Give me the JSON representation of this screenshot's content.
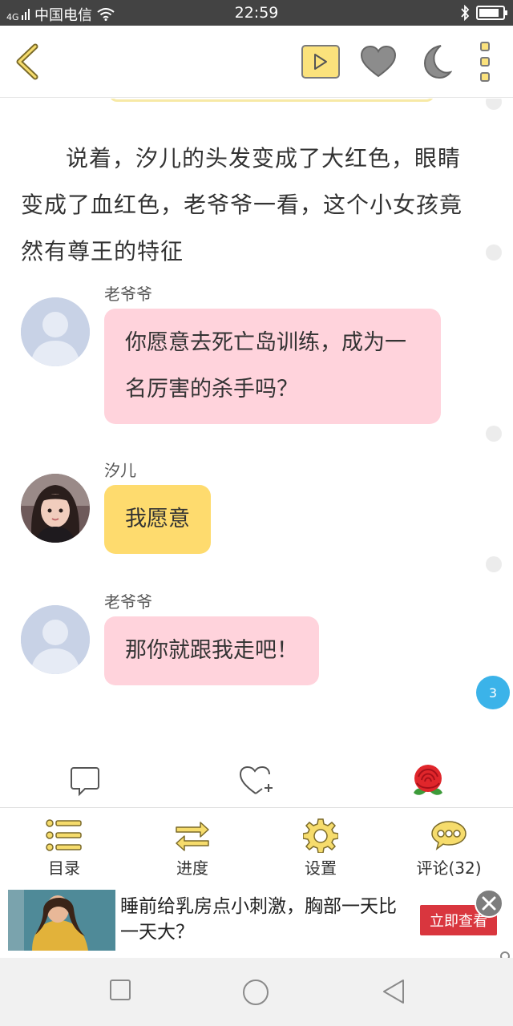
{
  "status_bar": {
    "signal": "4G",
    "carrier": "中国电信",
    "time": "22:59",
    "battery_level": 0.85
  },
  "toolbar": {
    "icons": [
      "back-icon",
      "play-icon",
      "heart-icon",
      "moon-icon",
      "more-icon"
    ],
    "accent_color": "#fbe27c"
  },
  "story": {
    "narration": "说着，汐儿的头发变成了大红色，眼睛变成了血红色，老爷爷一看，这个小女孩竟然有尊王的特征",
    "messages": [
      {
        "speaker": "老爷爷",
        "text": "你愿意去死亡岛训练，成为一名厉害的杀手吗？",
        "avatar": "default-avatar",
        "bubble_color": "#ffd3dc"
      },
      {
        "speaker": "汐儿",
        "text": "我愿意",
        "avatar": "girl-avatar",
        "bubble_color": "#fedb6e"
      },
      {
        "speaker": "老爷爷",
        "text": "那你就跟我走吧！",
        "avatar": "default-avatar",
        "bubble_color": "#ffd3dc"
      }
    ],
    "unread_count": "3"
  },
  "actions": {
    "icons": [
      "comment-icon",
      "like-icon",
      "rose-icon"
    ]
  },
  "bottom_nav": {
    "items": [
      {
        "label": "目录",
        "icon": "list-icon"
      },
      {
        "label": "进度",
        "icon": "progress-arrows-icon"
      },
      {
        "label": "设置",
        "icon": "gear-icon"
      },
      {
        "label": "评论(32)",
        "icon": "chat-bubble-icon"
      }
    ]
  },
  "ad": {
    "text": "睡前给乳房点小刺激，胸部一天比一天大？",
    "cta": "立即查看"
  },
  "system_nav": {
    "icons": [
      "recents-icon",
      "home-icon",
      "back-triangle-icon"
    ]
  }
}
